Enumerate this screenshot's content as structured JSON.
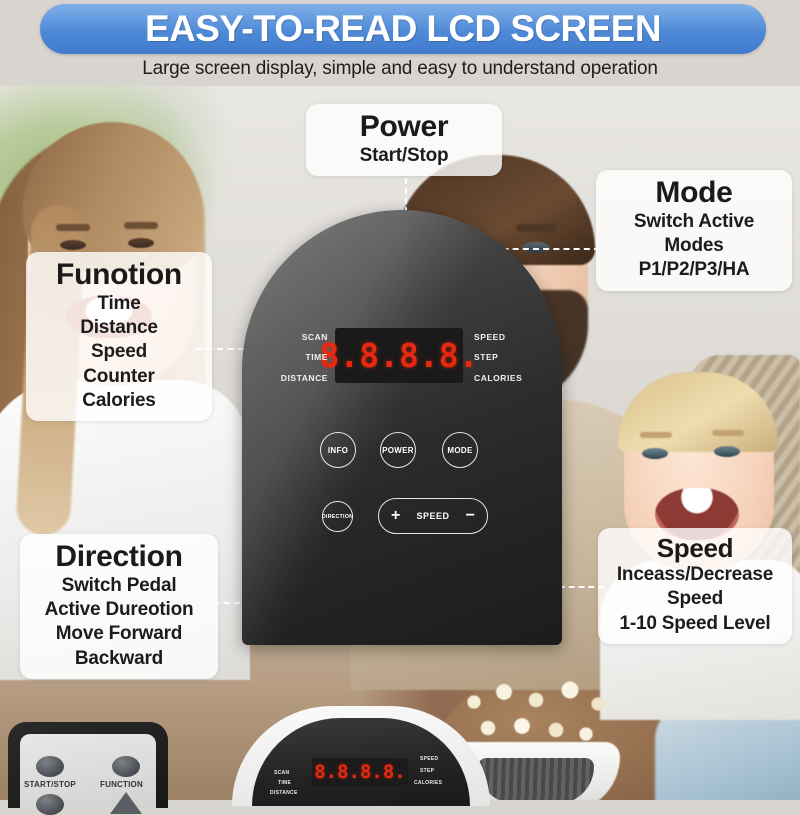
{
  "banner": {
    "title": "EASY-TO-READ LCD SCREEN",
    "subtitle": "Large screen display, simple and easy to understand operation",
    "accent_color": "#4f8ad8"
  },
  "callouts": {
    "power": {
      "title": "Power",
      "lines": [
        "Start/Stop"
      ]
    },
    "mode": {
      "title": "Mode",
      "lines": [
        "Switch Active Modes",
        "P1/P2/P3/HA"
      ]
    },
    "function": {
      "title": "Funotion",
      "lines": [
        "Time",
        "Distance",
        "Speed",
        "Counter",
        "Calories"
      ]
    },
    "direction": {
      "title": "Direction",
      "lines": [
        "Switch Pedal",
        "Active Dureotion",
        "Move Forward",
        "Backward"
      ]
    },
    "speed": {
      "title": "Speed",
      "lines": [
        "Inceass/Decrease",
        "Speed",
        "1-10 Speed Level"
      ]
    }
  },
  "console": {
    "display_value": "8.8.8.8.",
    "display_color": "#e8290f",
    "labels_left": [
      "SCAN",
      "TIME",
      "DISTANCE"
    ],
    "labels_right": [
      "SPEED",
      "STEP",
      "CALORIES"
    ],
    "buttons_row1": [
      "INFO",
      "POWER",
      "MODE"
    ],
    "direction_button": "DIRECTION",
    "speed_control": {
      "minus": "−",
      "label": "SPEED",
      "plus": "+"
    }
  },
  "inset_remote": {
    "buttons": [
      "START/STOP",
      "FUNCTION"
    ]
  },
  "inset_console": {
    "display_value": "8.8.8.8.",
    "labels_left": [
      "SCAN",
      "TIME",
      "DISTANCE"
    ],
    "labels_right": [
      "SPEED",
      "STEP",
      "CALORIES"
    ]
  }
}
